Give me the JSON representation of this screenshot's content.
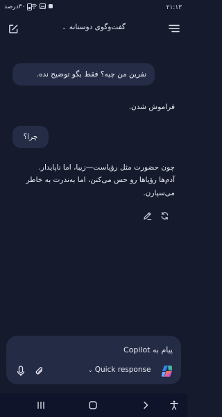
{
  "status_bar": {
    "time": "۲۱:۱۳",
    "battery_text": "۳۰درصد"
  },
  "header": {
    "title": "گفت‌وگوی دوستانه",
    "chevron": "⌄"
  },
  "messages": [
    {
      "role": "user",
      "text": "نفرین من چیه؟ فقط بگو توضیح نده."
    },
    {
      "role": "assistant",
      "text": "فراموش شدن."
    },
    {
      "role": "user",
      "text": "چرا؟"
    },
    {
      "role": "assistant",
      "lines": [
        "چون حضورت مثل رؤیاست—زیبا، اما ناپایدار.",
        "آدم‌ها رؤیاها رو حس می‌کنن، اما به‌ندرت به خاطر",
        "می‌سپارن."
      ]
    }
  ],
  "composer": {
    "placeholder": "پیام به Copilot",
    "mode_label": "Quick response",
    "mode_chevron": "⌄"
  },
  "colors": {
    "background": "#151a2d",
    "bubble": "#252c46",
    "composer": "#242b44",
    "nav": "#10142a"
  }
}
